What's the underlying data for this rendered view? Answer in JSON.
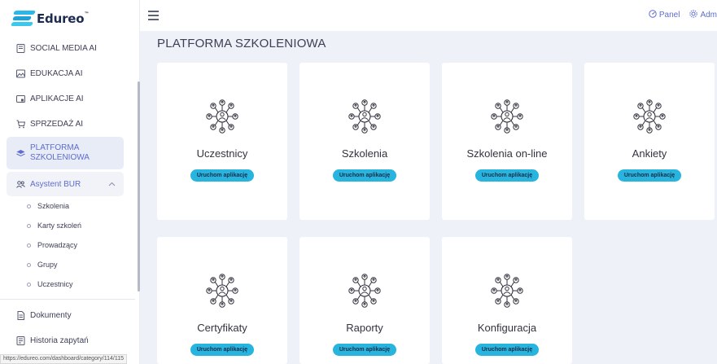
{
  "app": {
    "logo_text": "Edureo",
    "logo_tm": "™"
  },
  "sidebar": {
    "items": [
      {
        "label": "SOCIAL MEDIA AI",
        "icon": "document-icon"
      },
      {
        "label": "EDUKACJA AI",
        "icon": "image-icon"
      },
      {
        "label": "APLIKACJE AI",
        "icon": "app-icon"
      },
      {
        "label": "SPRZEDAŻ AI",
        "icon": "cart-icon"
      }
    ],
    "active": {
      "label_line1": "PLATFORMA",
      "label_line2": "SZKOLENIOWA",
      "icon": "layers-icon"
    },
    "group": {
      "label": "Asystent BUR",
      "icon": "users-icon",
      "chevron": "^"
    },
    "sub_items": [
      "Szkolenia",
      "Karty szkoleń",
      "Prowadzący",
      "Grupy",
      "Uczestnicy"
    ],
    "bottom_items": [
      {
        "label": "Dokumenty",
        "icon": "document-icon"
      },
      {
        "label": "Historia zapytań",
        "icon": "history-icon"
      }
    ]
  },
  "statusbar": {
    "url": "https://edureo.com/dashboard/category/114/115"
  },
  "topbar": {
    "panel_label": "Panel",
    "admin_label": "Adm"
  },
  "main": {
    "title": "PLATFORMA SZKOLENIOWA",
    "button_label": "Uruchom aplikację",
    "cards": [
      {
        "title": "Uczestnicy"
      },
      {
        "title": "Szkolenia"
      },
      {
        "title": "Szkolenia on-line"
      },
      {
        "title": "Ankiety"
      },
      {
        "title": "Certyfikaty"
      },
      {
        "title": "Raporty"
      },
      {
        "title": "Konfiguracja"
      }
    ]
  },
  "colors": {
    "accent": "#5e6dcf",
    "button": "#27b5e0",
    "background": "#eef1f7"
  }
}
